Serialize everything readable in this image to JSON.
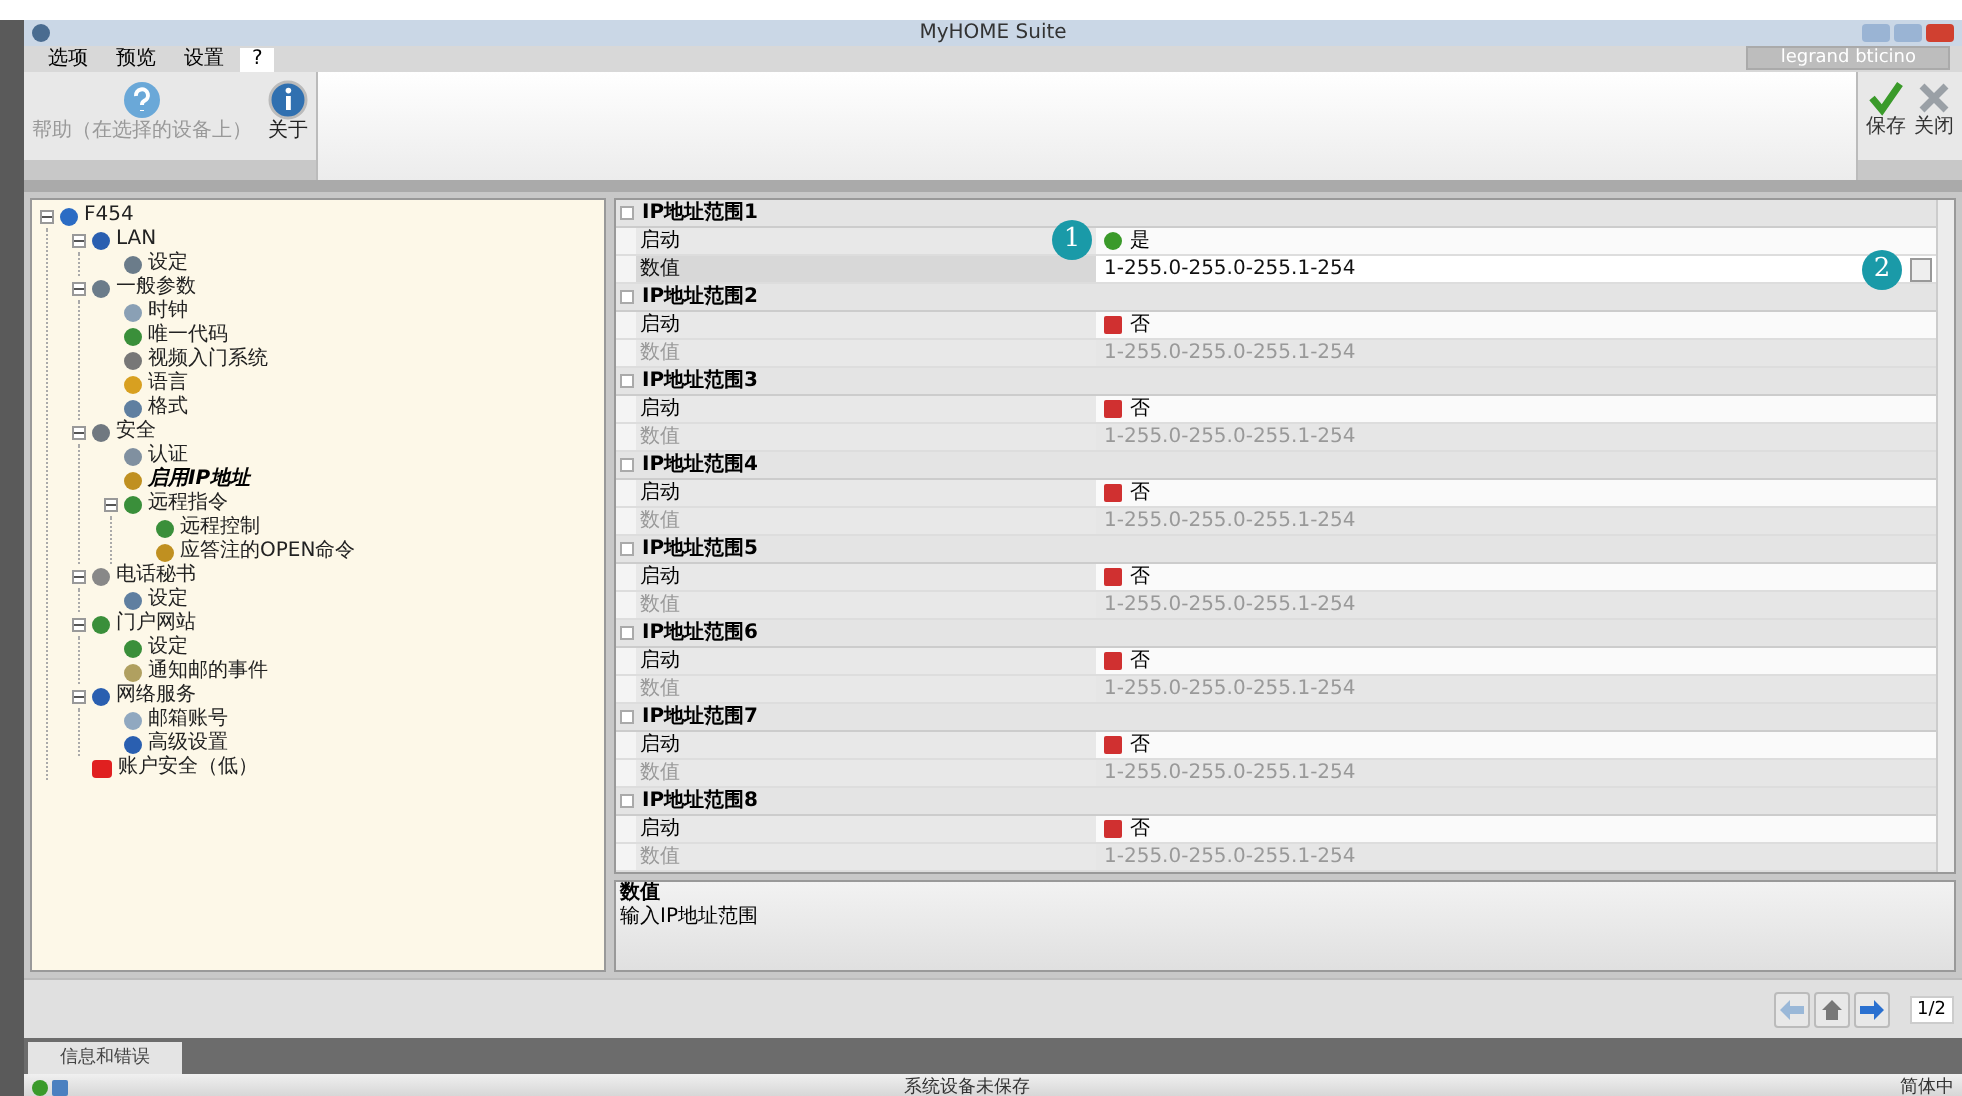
{
  "window": {
    "title": "MyHOME Suite",
    "brand": "legrand bticino"
  },
  "menu_tabs": [
    {
      "label": "选项",
      "selected": false
    },
    {
      "label": "预览",
      "selected": false
    },
    {
      "label": "设置",
      "selected": false
    },
    {
      "label": "?",
      "selected": true
    }
  ],
  "toolbar": [
    {
      "label": "帮助（在选择的设备上）",
      "kind": "help",
      "disabled": true
    },
    {
      "label": "关于",
      "kind": "info",
      "disabled": false
    }
  ],
  "actions": [
    {
      "label": "保存",
      "kind": "save"
    },
    {
      "label": "关闭",
      "kind": "close"
    }
  ],
  "tree": [
    {
      "label": "F454",
      "kind": "device",
      "expanded": true,
      "selected": false,
      "children": [
        {
          "label": "LAN",
          "kind": "monitor",
          "expanded": true,
          "selected": false,
          "children": [
            {
              "label": "设定",
              "kind": "gear",
              "selected": false
            }
          ]
        },
        {
          "label": "一般参数",
          "kind": "gear",
          "expanded": true,
          "selected": false,
          "children": [
            {
              "label": "时钟",
              "kind": "clock",
              "selected": false
            },
            {
              "label": "唯一代码",
              "kind": "globe",
              "selected": false
            },
            {
              "label": "视频入门系统",
              "kind": "camera",
              "selected": false
            },
            {
              "label": "语言",
              "kind": "flag",
              "selected": false
            },
            {
              "label": "格式",
              "kind": "doc",
              "selected": false
            }
          ]
        },
        {
          "label": "安全",
          "kind": "shield",
          "expanded": true,
          "selected": false,
          "children": [
            {
              "label": "认证",
              "kind": "card",
              "selected": false
            },
            {
              "label": "启用IP地址",
              "kind": "lock",
              "selected": true
            },
            {
              "label": "远程指令",
              "kind": "globe",
              "expanded": true,
              "selected": false,
              "children": [
                {
                  "label": "远程控制",
                  "kind": "globe",
                  "selected": false
                },
                {
                  "label": "应答注的OPEN命令",
                  "kind": "lock",
                  "selected": false
                }
              ]
            }
          ]
        },
        {
          "label": "电话秘书",
          "kind": "phone",
          "expanded": true,
          "selected": false,
          "children": [
            {
              "label": "设定",
              "kind": "doc",
              "selected": false
            }
          ]
        },
        {
          "label": "门户网站",
          "kind": "globe",
          "expanded": true,
          "selected": false,
          "children": [
            {
              "label": "设定",
              "kind": "globe",
              "selected": false
            },
            {
              "label": "通知邮的事件",
              "kind": "grid",
              "selected": false
            }
          ]
        },
        {
          "label": "网络服务",
          "kind": "monitor",
          "expanded": true,
          "selected": false,
          "children": [
            {
              "label": "邮箱账号",
              "kind": "mail",
              "selected": false
            },
            {
              "label": "高级设置",
              "kind": "monitor",
              "selected": false
            }
          ]
        },
        {
          "label": "账户安全（低）",
          "kind": "alert",
          "selected": false
        }
      ]
    }
  ],
  "ranges": [
    {
      "title": "IP地址范围1",
      "enabled_label": "启动",
      "enabled": true,
      "enabled_text": "是",
      "value_label": "数值",
      "value": "1-255.0-255.0-255.1-254",
      "callout": "1",
      "edit_callout": "2"
    },
    {
      "title": "IP地址范围2",
      "enabled_label": "启动",
      "enabled": false,
      "enabled_text": "否",
      "value_label": "数值",
      "value": "1-255.0-255.0-255.1-254"
    },
    {
      "title": "IP地址范围3",
      "enabled_label": "启动",
      "enabled": false,
      "enabled_text": "否",
      "value_label": "数值",
      "value": "1-255.0-255.0-255.1-254"
    },
    {
      "title": "IP地址范围4",
      "enabled_label": "启动",
      "enabled": false,
      "enabled_text": "否",
      "value_label": "数值",
      "value": "1-255.0-255.0-255.1-254"
    },
    {
      "title": "IP地址范围5",
      "enabled_label": "启动",
      "enabled": false,
      "enabled_text": "否",
      "value_label": "数值",
      "value": "1-255.0-255.0-255.1-254"
    },
    {
      "title": "IP地址范围6",
      "enabled_label": "启动",
      "enabled": false,
      "enabled_text": "否",
      "value_label": "数值",
      "value": "1-255.0-255.0-255.1-254"
    },
    {
      "title": "IP地址范围7",
      "enabled_label": "启动",
      "enabled": false,
      "enabled_text": "否",
      "value_label": "数值",
      "value": "1-255.0-255.0-255.1-254"
    },
    {
      "title": "IP地址范围8",
      "enabled_label": "启动",
      "enabled": false,
      "enabled_text": "否",
      "value_label": "数值",
      "value": "1-255.0-255.0-255.1-254"
    }
  ],
  "description": {
    "title": "数值",
    "text": "输入IP地址范围"
  },
  "pager": {
    "page": "1/2"
  },
  "bottom_tab": "信息和错误",
  "status_bar": {
    "message": "系统设备未保存",
    "language": "简体中"
  }
}
